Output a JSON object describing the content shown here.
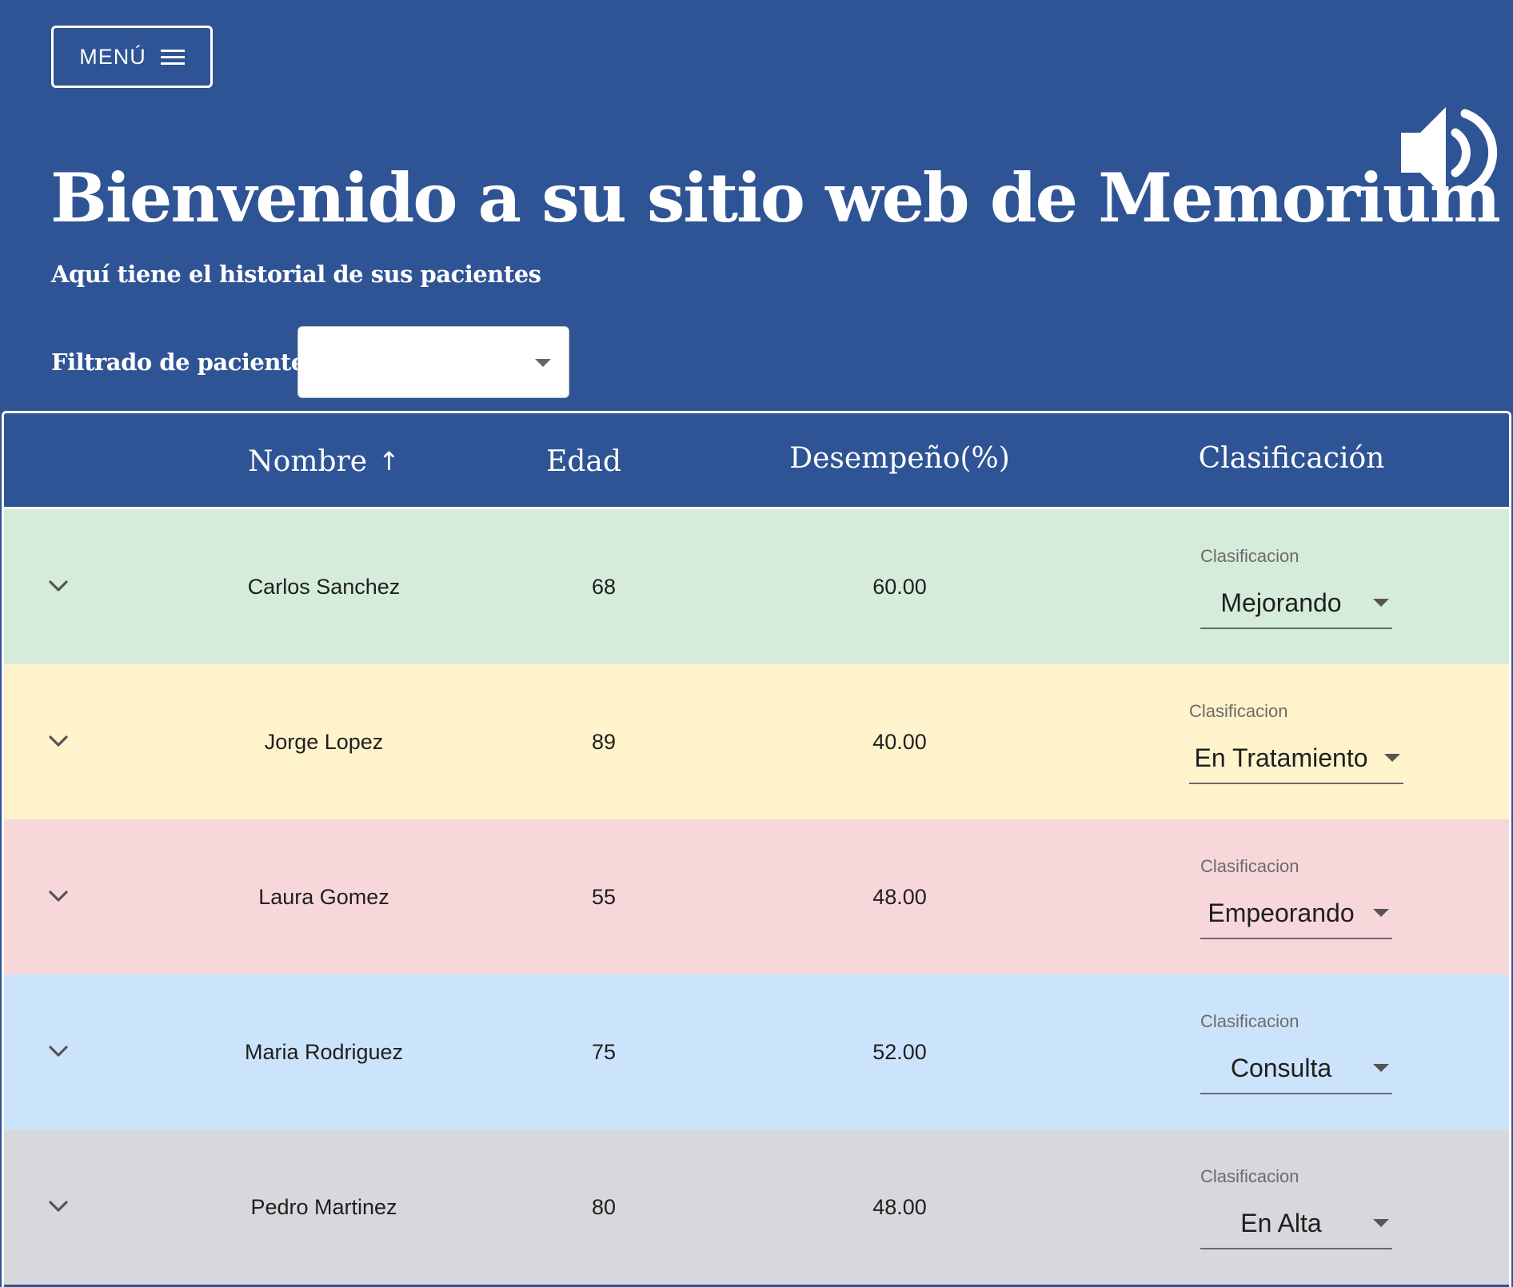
{
  "header": {
    "menu_label": "MENÚ",
    "title": "Bienvenido a su sitio web de Memorium",
    "subtitle": "Aquí tiene el historial de sus pacientes",
    "filter_label": "Filtrado de pacientes",
    "filter_value": ""
  },
  "icons": {
    "menu": "hamburger-icon",
    "audio": "speaker-icon",
    "sort": "arrow-up-icon",
    "expand": "chevron-down-icon",
    "dropdown": "caret-down-icon"
  },
  "table": {
    "columns": [
      "Nombre",
      "Edad",
      "Desempeño(%)",
      "Clasificación"
    ],
    "sort_arrow": "↑",
    "rows": [
      {
        "nombre": "Carlos Sanchez",
        "edad": "68",
        "desempeno": "60.00",
        "clasificacion_label": "Clasificacion",
        "clasificacion": "Mejorando",
        "color": "#d5ecdb"
      },
      {
        "nombre": "Jorge Lopez",
        "edad": "89",
        "desempeno": "40.00",
        "clasificacion_label": "Clasificacion",
        "clasificacion": "En Tratamiento",
        "color": "#fff3cc"
      },
      {
        "nombre": "Laura Gomez",
        "edad": "55",
        "desempeno": "48.00",
        "clasificacion_label": "Clasificacion",
        "clasificacion": "Empeorando",
        "color": "#f8d7db"
      },
      {
        "nombre": "Maria Rodriguez",
        "edad": "75",
        "desempeno": "52.00",
        "clasificacion_label": "Clasificacion",
        "clasificacion": "Consulta",
        "color": "#cce4fb"
      },
      {
        "nombre": "Pedro Martinez",
        "edad": "80",
        "desempeno": "48.00",
        "clasificacion_label": "Clasificacion",
        "clasificacion": "En Alta",
        "color": "#d6d8db"
      }
    ]
  },
  "colors": {
    "background": "#2f5495",
    "header_text": "#ffffff"
  }
}
